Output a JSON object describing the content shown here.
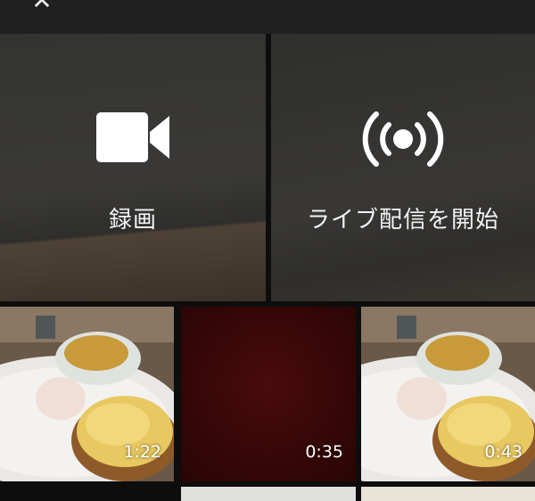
{
  "header": {
    "close_icon": "close-icon"
  },
  "actions": [
    {
      "label": "録画",
      "icon": "video-camera-icon"
    },
    {
      "label": "ライブ配信を開始",
      "icon": "live-broadcast-icon"
    }
  ],
  "videos": [
    {
      "duration": "1:22"
    },
    {
      "duration": "0:35"
    },
    {
      "duration": "0:43"
    }
  ],
  "colors": {
    "background": "#0d0d0d",
    "panel": "#363533",
    "text": "#f2f2f2",
    "dark_red_tile": "#3b0808"
  }
}
